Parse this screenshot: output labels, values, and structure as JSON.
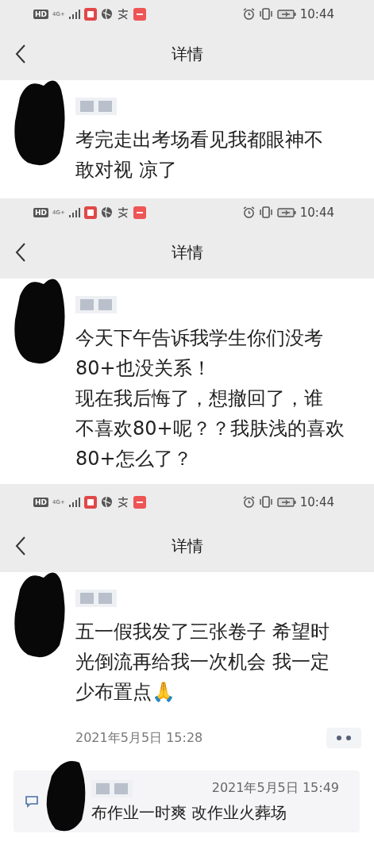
{
  "screens": [
    {
      "status_bar": {
        "hd": "HD",
        "network": "4G+",
        "time": "10:44"
      },
      "nav": {
        "title": "详情"
      },
      "post": {
        "lines": [
          "考完走出考场看见我都眼神不",
          "敢对视 凉了"
        ]
      }
    },
    {
      "status_bar": {
        "hd": "HD",
        "network": "4G+",
        "time": "10:44"
      },
      "nav": {
        "title": "详情"
      },
      "post": {
        "lines": [
          "今天下午告诉我学生你们没考",
          "80+也没关系！",
          "现在我后悔了，想撤回了，谁",
          "不喜欢80+呢？？我肤浅的喜欢",
          "80+怎么了？"
        ]
      }
    },
    {
      "status_bar": {
        "hd": "HD",
        "network": "4G+",
        "time": "10:44"
      },
      "nav": {
        "title": "详情"
      },
      "post": {
        "lines": [
          "五一假我发了三张卷子 希望时",
          "光倒流再给我一次机会 我一定",
          "少布置点🙏"
        ],
        "time": "2021年5月5日 15:28"
      },
      "comment": {
        "time": "2021年5月5日 15:49",
        "text": "布作业一时爽 改作业火葬场"
      }
    }
  ]
}
